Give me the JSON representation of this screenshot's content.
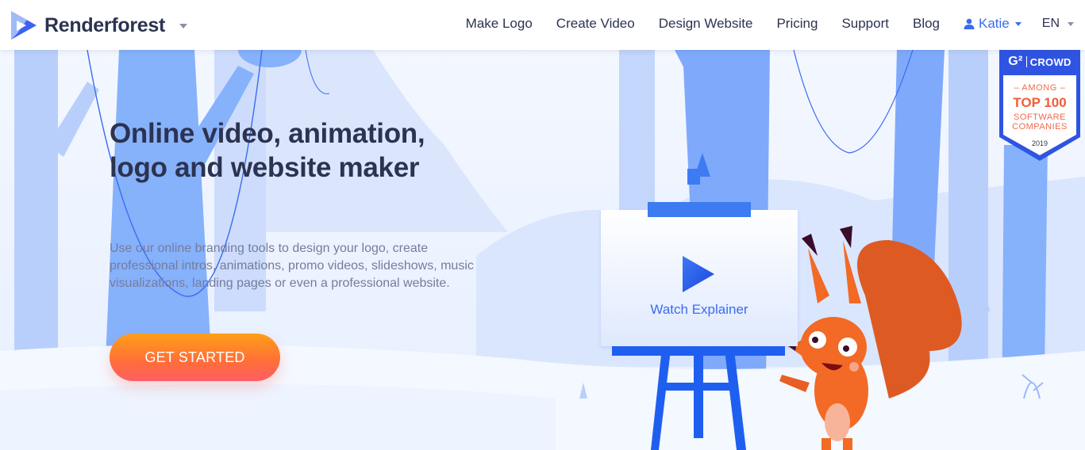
{
  "navbar": {
    "brand": "Renderforest",
    "links": [
      "Make Logo",
      "Create Video",
      "Design Website",
      "Pricing",
      "Support",
      "Blog"
    ],
    "user": "Katie",
    "language": "EN"
  },
  "hero": {
    "headline": "Online video, animation, logo and website maker",
    "subtext": "Use our online branding tools to design your logo, create professional intros, animations, promo videos, slideshows, music visualizations, landing pages or even a professional website.",
    "cta_label": "GET STARTED",
    "watch_label": "Watch Explainer"
  },
  "badge": {
    "logo": "G²",
    "brand": "CROWD",
    "among": "– AMONG –",
    "top": "TOP 100",
    "line1": "SOFTWARE",
    "line2": "COMPANIES",
    "year": "2019"
  },
  "colors": {
    "brand_dark": "#2c3350",
    "accent_blue": "#3b6cf0",
    "cta_orange": "#ff7a30",
    "squirrel": "#f26a25"
  }
}
